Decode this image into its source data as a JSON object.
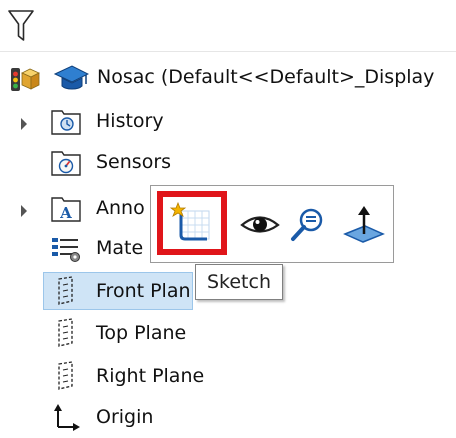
{
  "filter": {
    "icon": "filter-icon"
  },
  "tree": {
    "root": {
      "label": "Nosac  (Default<<Default>_Display"
    },
    "items": [
      {
        "label": "History",
        "icon": "history-folder-icon",
        "expandable": true
      },
      {
        "label": "Sensors",
        "icon": "sensors-folder-icon",
        "expandable": false
      },
      {
        "label": "Anno",
        "icon": "annotations-folder-icon",
        "expandable": true
      },
      {
        "label": "Mate",
        "icon": "material-icon",
        "expandable": false
      },
      {
        "label": "Front Plan",
        "icon": "plane-icon",
        "selected": true
      },
      {
        "label": "Top Plane",
        "icon": "plane-icon"
      },
      {
        "label": "Right Plane",
        "icon": "plane-icon"
      },
      {
        "label": "Origin",
        "icon": "origin-icon"
      }
    ]
  },
  "context_toolbar": {
    "buttons": [
      {
        "icon": "sketch-icon",
        "highlighted": true
      },
      {
        "icon": "eye-icon"
      },
      {
        "icon": "zoom-to-selection-icon"
      },
      {
        "icon": "normal-to-icon"
      }
    ]
  },
  "tooltip": {
    "text": "Sketch"
  },
  "colors": {
    "highlight": "#e0151a",
    "selection": "#cfe4f6",
    "icon_blue": "#1a5aa8"
  }
}
